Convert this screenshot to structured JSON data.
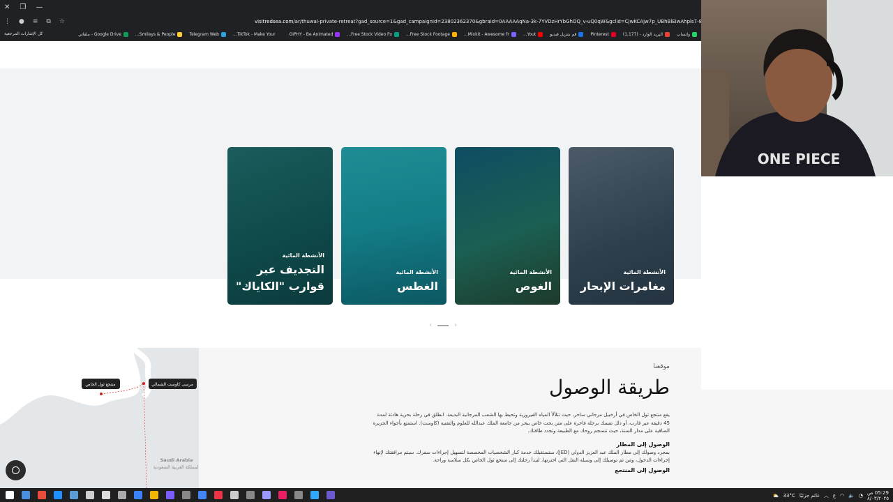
{
  "browser": {
    "url_host": "visitredsea.com",
    "url_rest": "/ar/thuwal-private-retreat?gad_source=1&gad_campaignid=23802362370&gbraid=0AAAAAqNa-3k-7YVDzHrYbGhOQ_v-uQ0qW&gclid=CjwKCAjw7p_UBhBlEiwAhpls7-8zKGBYj0ZndH9wmjpU",
    "bookmarks": [
      {
        "label": "واتساب",
        "color": "#25d366"
      },
      {
        "label": "البريد الوارد - (1,177)",
        "color": "#ea4335"
      },
      {
        "label": "Pinterest",
        "color": "#e60023"
      },
      {
        "label": "قم بتنزيل فيديو",
        "color": "#1a73e8"
      },
      {
        "label": "Yout...",
        "color": "#ff0000"
      },
      {
        "label": "Mixkit - Awesome fr...",
        "color": "#7b61ff"
      },
      {
        "label": "Free Stock Footage...",
        "color": "#ffb300"
      },
      {
        "label": "Free Stock Video Fo...",
        "color": "#05a081"
      },
      {
        "label": "GIPHY - Be Animated",
        "color": "#9933ff"
      },
      {
        "label": "TikTok - Make Your...",
        "color": "#222"
      },
      {
        "label": "Telegram Web",
        "color": "#2aa1da"
      },
      {
        "label": "Smileys & People...",
        "color": "#ffcc33"
      },
      {
        "label": "Google Drive - ملفاتي",
        "color": "#0f9d58"
      }
    ],
    "all_bookmarks": "كل الإشارات المرجعية"
  },
  "cards": [
    {
      "category": "الأنشطة المائية",
      "title": "مغامرات الإبحار",
      "bg": "linear-gradient(160deg,#4b5a66,#2d3f4d 60%,#24333f)"
    },
    {
      "category": "الأنشطة المائية",
      "title": "الغوص",
      "bg": "linear-gradient(160deg,#0f4d63,#1b5f52 55%,#1d3a2b)"
    },
    {
      "category": "الأنشطة المائية",
      "title": "الغطس",
      "bg": "linear-gradient(170deg,#1f8d95,#137c86 50%,#0c5862)"
    },
    {
      "category": "الأنشطة المائية",
      "title": "التجديف عبر قوارب \"الكاياك\"",
      "bg": "linear-gradient(160deg,#1c5c5c,#0f4a4a 55%,#0b3a3c)"
    }
  ],
  "location": {
    "eyebrow": "موقعنا",
    "heading": "طريقة الوصول",
    "intro": "يقع منتجع ثول الخاص في أرخبيل مرجاني ساحر، حيث تتلألأ المياه الفيروزية وتحيط بها الشعب المرجانية البديعة. انطلق في رحلة بحرية هادئة لمدة 45 دقيقة عبر قارب، أو دلل نفسك برحلة فاخرة على متن يخت خاص يبحر من جامعة الملك عبدالله للعلوم والتقنية (كاوست). استمتع بأجواء الجزيرة الصافية على مدار السنة، حيث تنسجم روحك مع الطبيعة وتجدد طاقتك.",
    "airport_title": "الوصول إلى المطار",
    "airport_text": "بمجرد وصولك إلى مطار الملك عبد العزيز الدولي (JED)، ستستقبلك خدمة كبار الشخصيات المخصصة لتسهيل إجراءات سفرك. سيتم مرافقتك لإنهاء إجراءات الدخول، ومن ثم توصيلك إلى وسيلة النقل التي اخترتها، لتبدأ رحلتك إلى منتجع ثول الخاص بكل سلاسة وراحة.",
    "resort_title": "الوصول إلى المنتجع"
  },
  "map": {
    "resort_label": "منتجع ثول الخاص",
    "port_label": "مرسى كاوست الشمالي",
    "country_en": "Saudi Arabia",
    "country_ar": "المملكة العربية السعودية"
  },
  "taskbar": {
    "temp": "33°C",
    "weather": "غائم جزئيًا",
    "time": "05:29 ص",
    "date": "٨/٠٣/٢٠٢٥"
  }
}
